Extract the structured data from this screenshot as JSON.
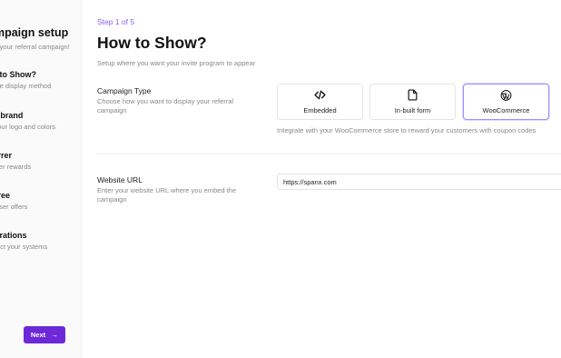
{
  "sidebar": {
    "title": "Campaign setup",
    "subtitle": "Setup your referral campaign!",
    "items": [
      {
        "title": "How to Show?",
        "desc": "Choose display method"
      },
      {
        "title": "Your brand",
        "desc": "Add your logo and colors"
      },
      {
        "title": "Referrer",
        "desc": "Referrer rewards"
      },
      {
        "title": "Referee",
        "desc": "New user offers"
      },
      {
        "title": "Integrations",
        "desc": "Connect your systems"
      }
    ],
    "next_label": "Next",
    "next_icon": "arrow-right-icon"
  },
  "main": {
    "step": "Step 1 of 5",
    "title": "How to Show?",
    "subtitle": "Setup where you want your invite program to appear",
    "campaign_type": {
      "label": "Campaign Type",
      "desc": "Choose how you want to display your referral campaign",
      "options": [
        {
          "label": "Embedded",
          "icon": "code-icon"
        },
        {
          "label": "In-built form",
          "icon": "file-icon"
        },
        {
          "label": "WooCommerce",
          "icon": "wordpress-icon"
        }
      ],
      "selected": "WooCommerce",
      "hint": "Integrate with your WooCommerce store to reward your customers with coupon codes"
    },
    "website_url": {
      "label": "Website URL",
      "desc": "Enter your website URL where you embed the campaign",
      "value": "https://spanx.com"
    }
  },
  "colors": {
    "accent": "#6d28d9",
    "step": "#8b5cf6",
    "selected_border": "#a78bfa"
  }
}
